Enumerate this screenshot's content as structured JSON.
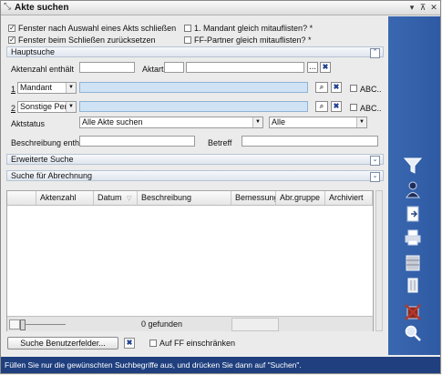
{
  "window": {
    "title": "Akte suchen",
    "controls": [
      "▾",
      "⊼",
      "✕"
    ]
  },
  "options": {
    "close_after_select": {
      "label": "Fenster nach Auswahl eines Akts schließen",
      "checked": true
    },
    "reset_on_close": {
      "label": "Fenster beim Schließen zurücksetzen",
      "checked": true
    },
    "mandant_list": {
      "label": "1. Mandant gleich mitauflisten? *",
      "checked": false
    },
    "ff_partner_list": {
      "label": "FF-Partner gleich mitauflisten? *",
      "checked": false
    }
  },
  "hauptsuche": {
    "title": "Hauptsuche",
    "aktenzahl_label": "Aktenzahl enthält",
    "aktart_label": "Aktart",
    "row1_number": "1",
    "row1_select": "Mandant",
    "row2_number": "2",
    "row2_select": "Sonstige Pers",
    "abc_label": "ABC..",
    "aktstatus_label": "Aktstatus",
    "aktstatus_value": "Alle Akte suchen",
    "aktstatus_second": "Alle",
    "beschreibung_label": "Beschreibung enth.",
    "betreff_label": "Betreff"
  },
  "sections": {
    "erweiterte": "Erweiterte Suche",
    "abrechnung": "Suche für Abrechnung"
  },
  "grid": {
    "columns": [
      "Aktenzahl",
      "Datum",
      "Beschreibung",
      "Bemessung",
      "Abr.gruppe",
      "Archiviert"
    ],
    "found_text": "0 gefunden"
  },
  "bottom": {
    "benutzerfelder_label": "Suche Benutzerfelder...",
    "auf_ff_label": "Auf FF einschränken"
  },
  "status": "Füllen Sie nur die gewünschten Suchbegriffe aus, und drücken Sie dann auf \"Suchen\".",
  "colors": {
    "accent_panel": "#3a68b0",
    "status_bar": "#1f3f7f",
    "input_highlight": "#cfe3f5"
  },
  "toolbar_icons": [
    "funnel-icon",
    "person-search-icon",
    "document-export-icon",
    "printer-icon",
    "cabinet-icon",
    "trash-icon",
    "cancel-search-icon",
    "magnifier-icon"
  ]
}
